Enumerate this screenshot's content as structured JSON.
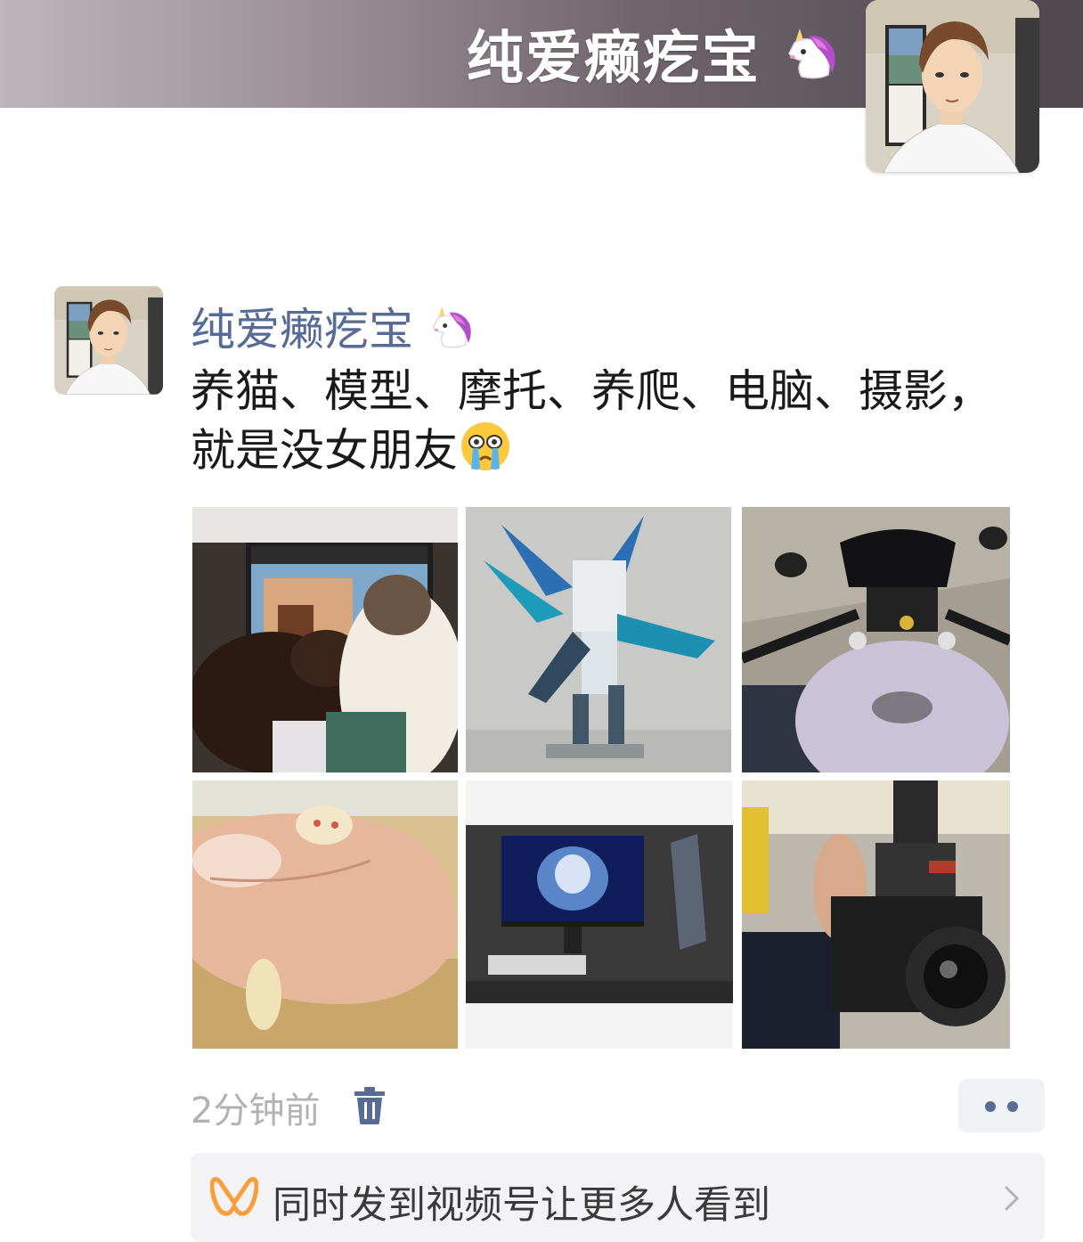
{
  "profile": {
    "cover_name": "纯爱癞疙宝",
    "cover_emoji": "unicorn-icon"
  },
  "post": {
    "author": "纯爱癞疙宝",
    "author_emoji": "unicorn-icon",
    "text": "养猫、模型、摩托、养爬、电脑、摄影，就是没女朋友",
    "text_emoji": "crying-face-icon",
    "images": [
      {
        "subject": "cats"
      },
      {
        "subject": "mecha-model"
      },
      {
        "subject": "motorcycle"
      },
      {
        "subject": "gecko"
      },
      {
        "subject": "computer-desk"
      },
      {
        "subject": "camera"
      }
    ],
    "time": "2分钟前",
    "delete_icon": "trash-icon",
    "more_icon": "more-dots-icon"
  },
  "channel_banner": {
    "text": "同时发到视频号让更多人看到",
    "icon": "channels-icon",
    "chevron": "chevron-right-icon"
  },
  "colors": {
    "name_link": "#576b95",
    "time_gray": "#b2b2b2",
    "channel_orange": "#fa9d3b"
  }
}
